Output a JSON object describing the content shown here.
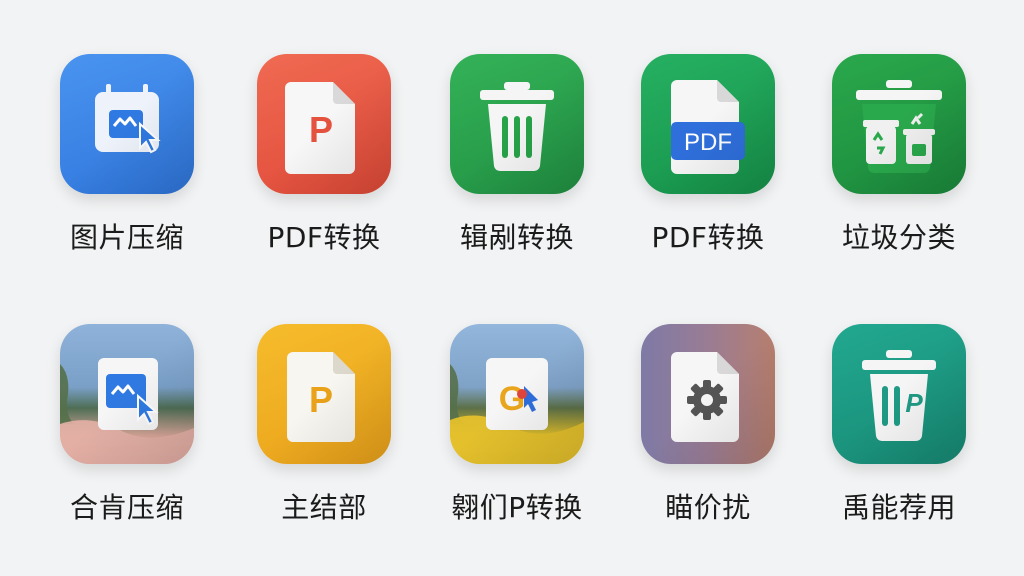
{
  "apps": [
    {
      "label": "图片压缩",
      "icon": "image-compress-icon",
      "color": "#3a86e8"
    },
    {
      "label": "PDF转换",
      "icon": "pdf-document-icon",
      "color": "#ea5a45",
      "glyph": "P"
    },
    {
      "label": "辑剐转换",
      "icon": "trash-can-icon",
      "color": "#27a348"
    },
    {
      "label": "PDF转换",
      "icon": "pdf-file-icon",
      "color": "#20a456",
      "glyph": "PDF"
    },
    {
      "label": "垃圾分类",
      "icon": "recycle-bins-icon",
      "color": "#229a45"
    },
    {
      "label": "合肯压缩",
      "icon": "photo-compress-icon",
      "color": "#6a8fb8"
    },
    {
      "label": "主结部",
      "icon": "document-p-icon",
      "color": "#f0b024",
      "glyph": "P"
    },
    {
      "label": "翱们P转换",
      "icon": "photo-convert-icon",
      "color": "#7f9bbe",
      "glyph": "G"
    },
    {
      "label": "瞄价扰",
      "icon": "settings-document-icon",
      "color": "#9a7e92"
    },
    {
      "label": "禹能荐用",
      "icon": "trash-p-icon",
      "color": "#1f9a84",
      "glyph": "P"
    }
  ]
}
